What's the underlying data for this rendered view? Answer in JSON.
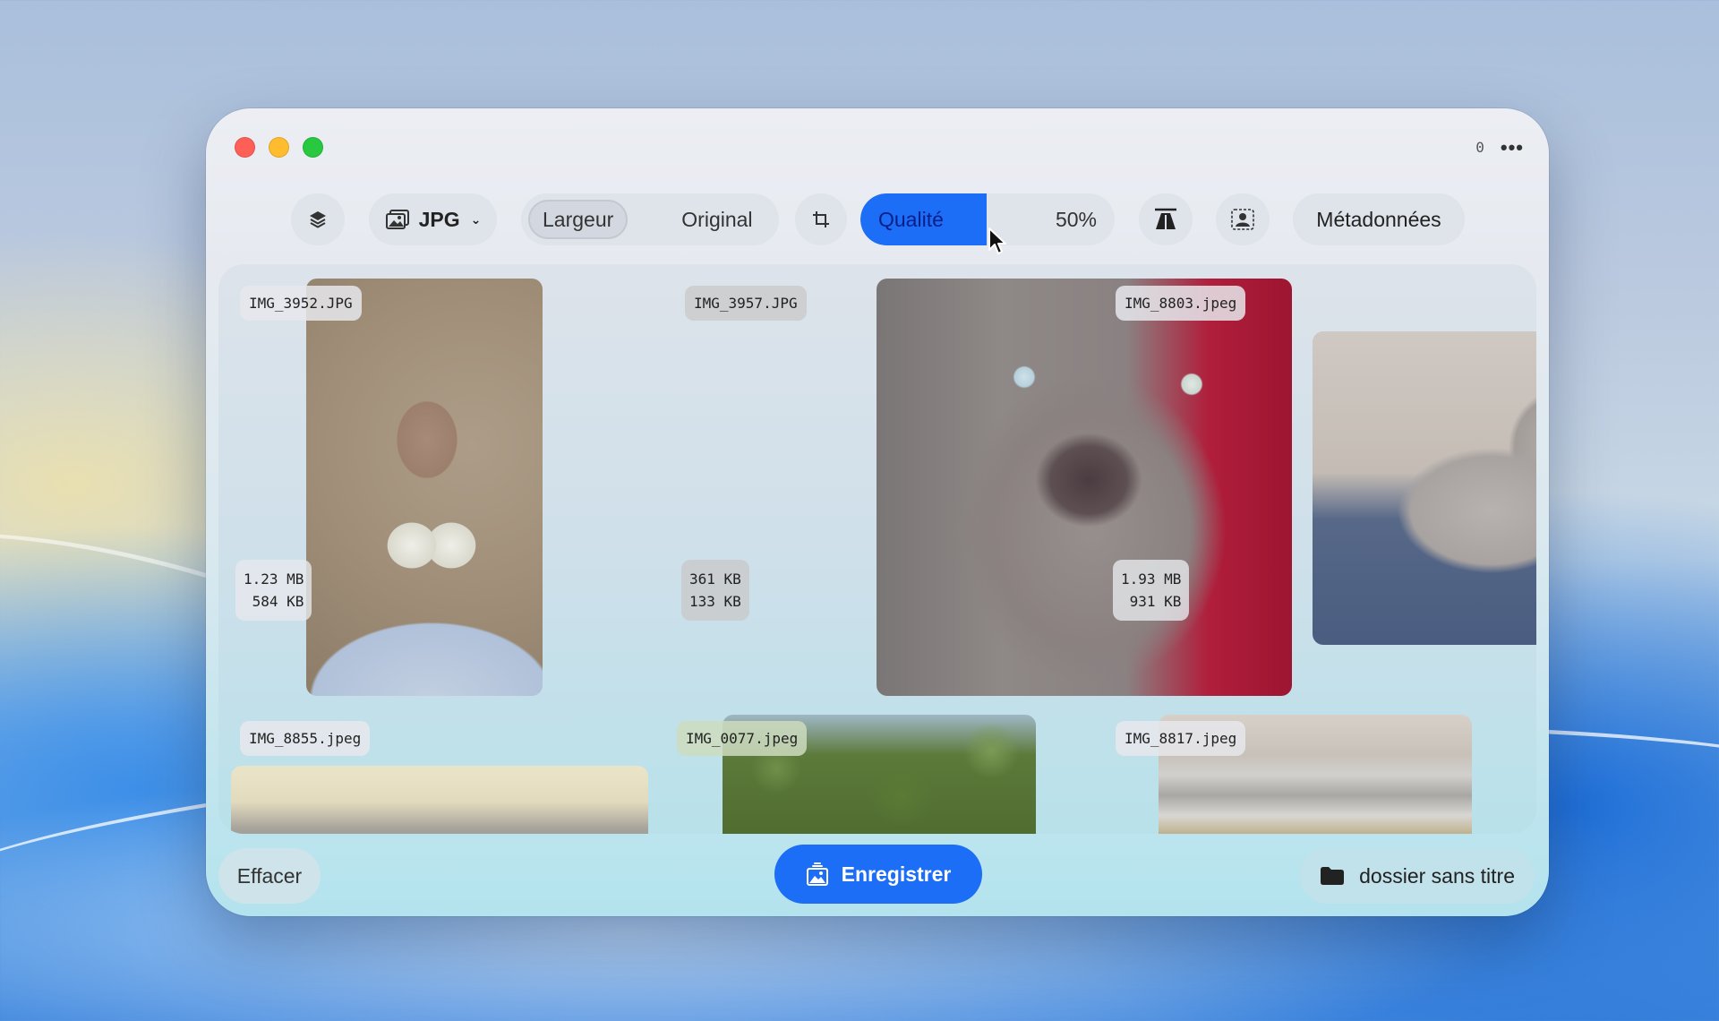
{
  "window": {
    "count": "0",
    "more_label": "•••"
  },
  "toolbar": {
    "format": "JPG",
    "resize_mode": "Largeur",
    "resize_value": "Original",
    "quality_label": "Qualité",
    "quality_value": "50%",
    "quality_fraction": 0.5,
    "metadata_label": "Métadonnées"
  },
  "images": [
    {
      "name": "IMG_3952.JPG",
      "original_size": "1.23 MB",
      "new_size": "584 KB"
    },
    {
      "name": "IMG_3957.JPG",
      "original_size": "361 KB",
      "new_size": "133 KB"
    },
    {
      "name": "IMG_8803.jpeg",
      "original_size": "1.93 MB",
      "new_size": "931 KB"
    },
    {
      "name": "IMG_8855.jpeg"
    },
    {
      "name": "IMG_0077.jpeg"
    },
    {
      "name": "IMG_8817.jpeg"
    }
  ],
  "footer": {
    "clear_label": "Effacer",
    "save_label": "Enregistrer",
    "folder_label": "dossier sans titre"
  },
  "colors": {
    "accent": "#1b6ef5",
    "close": "#fe5f57",
    "minimize": "#febc2e",
    "maximize": "#28c840"
  },
  "icons": [
    "layers-icon",
    "image-format-icon",
    "crop-icon",
    "perspective-icon",
    "person-icon",
    "save-image-icon",
    "folder-icon",
    "mouse-cursor-icon"
  ]
}
